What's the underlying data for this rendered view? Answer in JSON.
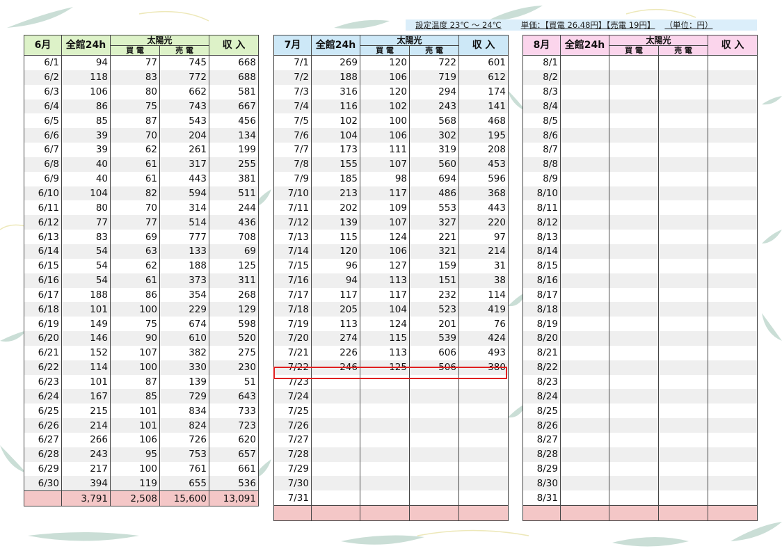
{
  "info": {
    "temp": "設定温度 23℃ ～ 24℃",
    "price": "単価：【買電 26.48円】【売電 19円】",
    "unit": "（単位：円）"
  },
  "headers": {
    "all24h": "全館24h",
    "solar": "太陽光",
    "buy": "買 電",
    "sell": "売 電",
    "income": "収 入"
  },
  "months": [
    {
      "label": "6月",
      "rows": [
        [
          "6/1",
          "94",
          "77",
          "745",
          "668"
        ],
        [
          "6/2",
          "118",
          "83",
          "772",
          "688"
        ],
        [
          "6/3",
          "106",
          "80",
          "662",
          "581"
        ],
        [
          "6/4",
          "86",
          "75",
          "743",
          "667"
        ],
        [
          "6/5",
          "85",
          "87",
          "543",
          "456"
        ],
        [
          "6/6",
          "39",
          "70",
          "204",
          "134"
        ],
        [
          "6/7",
          "39",
          "62",
          "261",
          "199"
        ],
        [
          "6/8",
          "40",
          "61",
          "317",
          "255"
        ],
        [
          "6/9",
          "40",
          "61",
          "443",
          "381"
        ],
        [
          "6/10",
          "104",
          "82",
          "594",
          "511"
        ],
        [
          "6/11",
          "80",
          "70",
          "314",
          "244"
        ],
        [
          "6/12",
          "77",
          "77",
          "514",
          "436"
        ],
        [
          "6/13",
          "83",
          "69",
          "777",
          "708"
        ],
        [
          "6/14",
          "54",
          "63",
          "133",
          "69"
        ],
        [
          "6/15",
          "54",
          "62",
          "188",
          "125"
        ],
        [
          "6/16",
          "54",
          "61",
          "373",
          "311"
        ],
        [
          "6/17",
          "188",
          "86",
          "354",
          "268"
        ],
        [
          "6/18",
          "101",
          "100",
          "229",
          "129"
        ],
        [
          "6/19",
          "149",
          "75",
          "674",
          "598"
        ],
        [
          "6/20",
          "146",
          "90",
          "610",
          "520"
        ],
        [
          "6/21",
          "152",
          "107",
          "382",
          "275"
        ],
        [
          "6/22",
          "114",
          "100",
          "330",
          "230"
        ],
        [
          "6/23",
          "101",
          "87",
          "139",
          "51"
        ],
        [
          "6/24",
          "167",
          "85",
          "729",
          "643"
        ],
        [
          "6/25",
          "215",
          "101",
          "834",
          "733"
        ],
        [
          "6/26",
          "214",
          "101",
          "824",
          "723"
        ],
        [
          "6/27",
          "266",
          "106",
          "726",
          "620"
        ],
        [
          "6/28",
          "243",
          "95",
          "753",
          "657"
        ],
        [
          "6/29",
          "217",
          "100",
          "761",
          "661"
        ],
        [
          "6/30",
          "394",
          "119",
          "655",
          "536"
        ]
      ],
      "total": [
        "",
        "3,791",
        "2,508",
        "15,600",
        "13,091"
      ]
    },
    {
      "label": "7月",
      "rows": [
        [
          "7/1",
          "269",
          "120",
          "722",
          "601"
        ],
        [
          "7/2",
          "188",
          "106",
          "719",
          "612"
        ],
        [
          "7/3",
          "316",
          "120",
          "294",
          "174"
        ],
        [
          "7/4",
          "116",
          "102",
          "243",
          "141"
        ],
        [
          "7/5",
          "102",
          "100",
          "568",
          "468"
        ],
        [
          "7/6",
          "104",
          "106",
          "302",
          "195"
        ],
        [
          "7/7",
          "173",
          "111",
          "319",
          "208"
        ],
        [
          "7/8",
          "155",
          "107",
          "560",
          "453"
        ],
        [
          "7/9",
          "185",
          "98",
          "694",
          "596"
        ],
        [
          "7/10",
          "213",
          "117",
          "486",
          "368"
        ],
        [
          "7/11",
          "202",
          "109",
          "553",
          "443"
        ],
        [
          "7/12",
          "139",
          "107",
          "327",
          "220"
        ],
        [
          "7/13",
          "115",
          "124",
          "221",
          "97"
        ],
        [
          "7/14",
          "120",
          "106",
          "321",
          "214"
        ],
        [
          "7/15",
          "96",
          "127",
          "159",
          "31"
        ],
        [
          "7/16",
          "94",
          "113",
          "151",
          "38"
        ],
        [
          "7/17",
          "117",
          "117",
          "232",
          "114"
        ],
        [
          "7/18",
          "205",
          "104",
          "523",
          "419"
        ],
        [
          "7/19",
          "113",
          "124",
          "201",
          "76"
        ],
        [
          "7/20",
          "274",
          "115",
          "539",
          "424"
        ],
        [
          "7/21",
          "226",
          "113",
          "606",
          "493"
        ],
        [
          "7/22",
          "246",
          "125",
          "506",
          "380"
        ],
        [
          "7/23",
          "",
          "",
          "",
          ""
        ],
        [
          "7/24",
          "",
          "",
          "",
          ""
        ],
        [
          "7/25",
          "",
          "",
          "",
          ""
        ],
        [
          "7/26",
          "",
          "",
          "",
          ""
        ],
        [
          "7/27",
          "",
          "",
          "",
          ""
        ],
        [
          "7/28",
          "",
          "",
          "",
          ""
        ],
        [
          "7/29",
          "",
          "",
          "",
          ""
        ],
        [
          "7/30",
          "",
          "",
          "",
          ""
        ],
        [
          "7/31",
          "",
          "",
          "",
          ""
        ]
      ],
      "total": [
        "",
        "",
        "",
        "",
        ""
      ]
    },
    {
      "label": "8月",
      "rows": [
        [
          "8/1",
          "",
          "",
          "",
          ""
        ],
        [
          "8/2",
          "",
          "",
          "",
          ""
        ],
        [
          "8/3",
          "",
          "",
          "",
          ""
        ],
        [
          "8/4",
          "",
          "",
          "",
          ""
        ],
        [
          "8/5",
          "",
          "",
          "",
          ""
        ],
        [
          "8/6",
          "",
          "",
          "",
          ""
        ],
        [
          "8/7",
          "",
          "",
          "",
          ""
        ],
        [
          "8/8",
          "",
          "",
          "",
          ""
        ],
        [
          "8/9",
          "",
          "",
          "",
          ""
        ],
        [
          "8/10",
          "",
          "",
          "",
          ""
        ],
        [
          "8/11",
          "",
          "",
          "",
          ""
        ],
        [
          "8/12",
          "",
          "",
          "",
          ""
        ],
        [
          "8/13",
          "",
          "",
          "",
          ""
        ],
        [
          "8/14",
          "",
          "",
          "",
          ""
        ],
        [
          "8/15",
          "",
          "",
          "",
          ""
        ],
        [
          "8/16",
          "",
          "",
          "",
          ""
        ],
        [
          "8/17",
          "",
          "",
          "",
          ""
        ],
        [
          "8/18",
          "",
          "",
          "",
          ""
        ],
        [
          "8/19",
          "",
          "",
          "",
          ""
        ],
        [
          "8/20",
          "",
          "",
          "",
          ""
        ],
        [
          "8/21",
          "",
          "",
          "",
          ""
        ],
        [
          "8/22",
          "",
          "",
          "",
          ""
        ],
        [
          "8/23",
          "",
          "",
          "",
          ""
        ],
        [
          "8/24",
          "",
          "",
          "",
          ""
        ],
        [
          "8/25",
          "",
          "",
          "",
          ""
        ],
        [
          "8/26",
          "",
          "",
          "",
          ""
        ],
        [
          "8/27",
          "",
          "",
          "",
          ""
        ],
        [
          "8/28",
          "",
          "",
          "",
          ""
        ],
        [
          "8/29",
          "",
          "",
          "",
          ""
        ],
        [
          "8/30",
          "",
          "",
          "",
          ""
        ],
        [
          "8/31",
          "",
          "",
          "",
          ""
        ]
      ],
      "total": [
        "",
        "",
        "",
        "",
        ""
      ]
    }
  ],
  "highlight": "7/22",
  "colors": {
    "jun_header": "#ddf2c8",
    "jul_header": "#cde8f7",
    "aug_header": "#fbd5ec",
    "total_row": "#f4c7c7",
    "highlight_border": "#e02020",
    "leaf": "#8fb8a8"
  }
}
